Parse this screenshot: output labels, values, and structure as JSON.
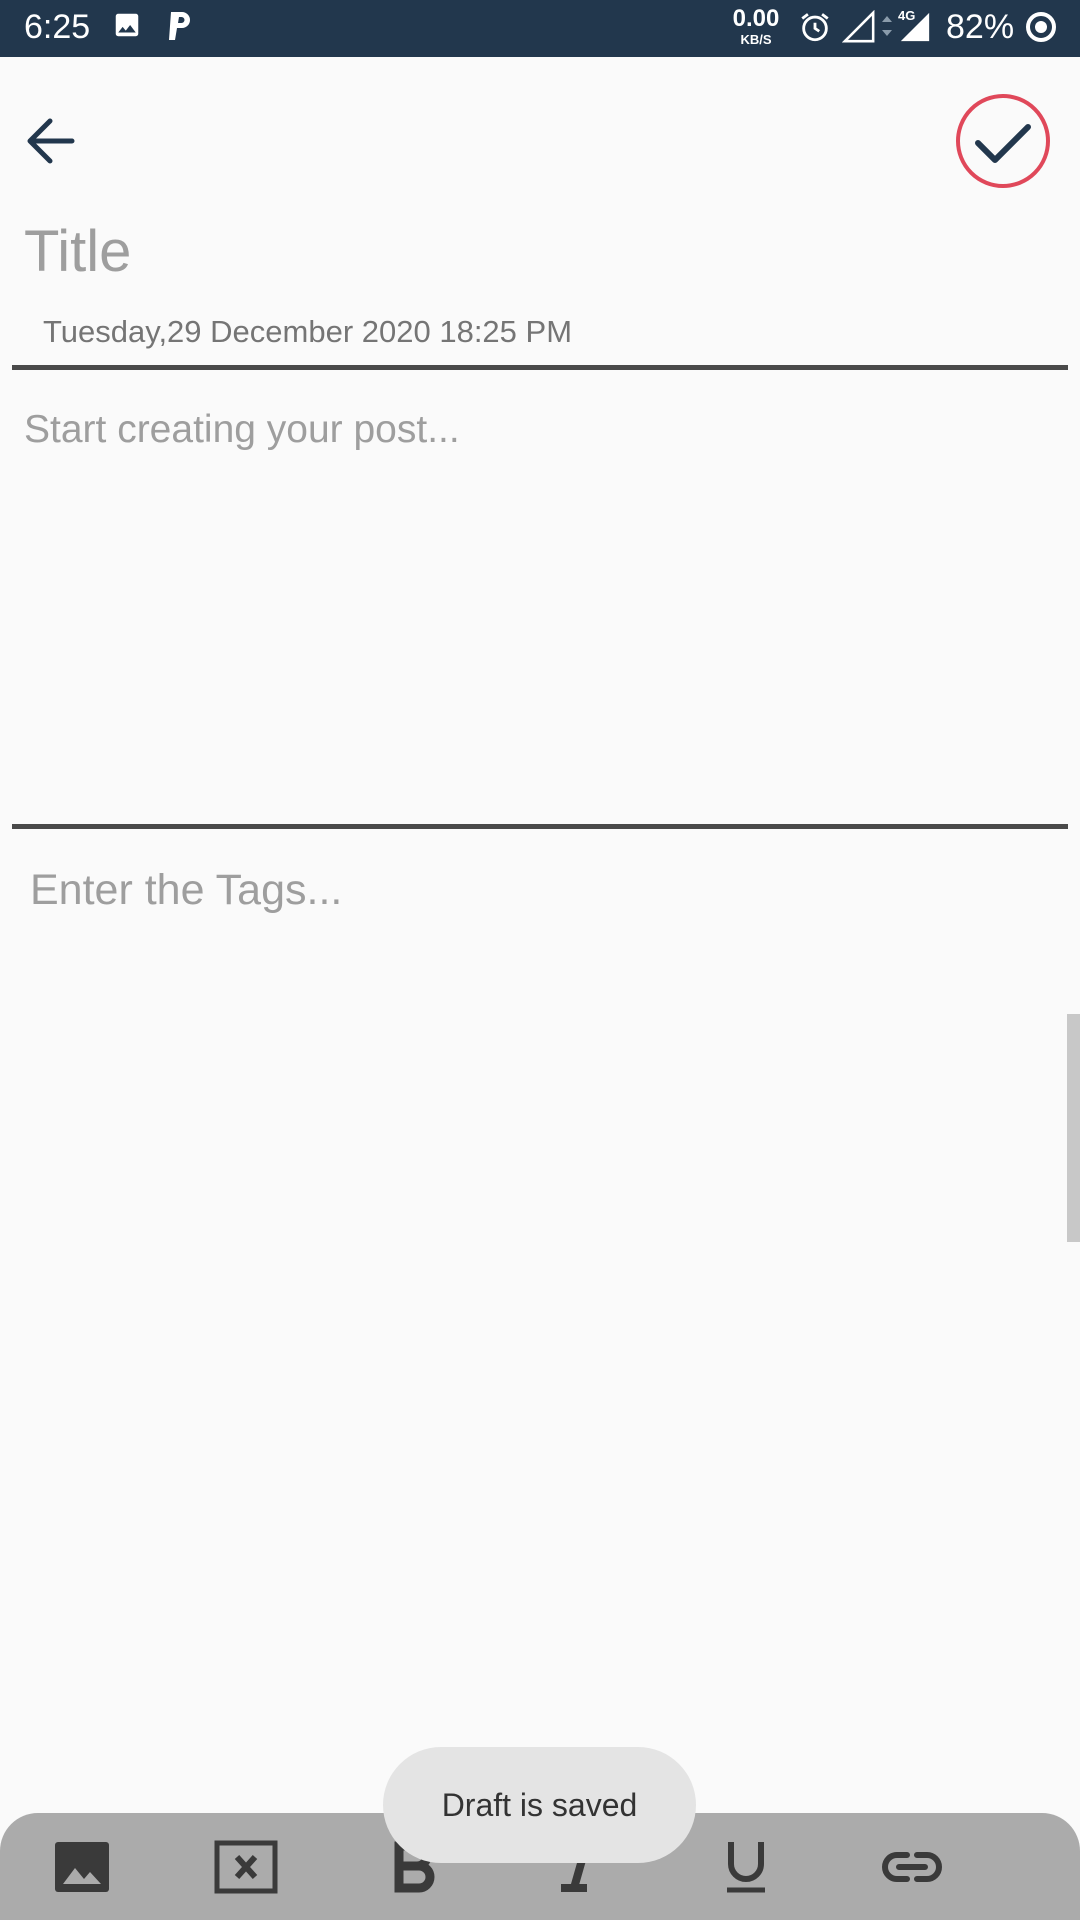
{
  "status_bar": {
    "time": "6:25",
    "network_speed_value": "0.00",
    "network_speed_unit": "KB/S",
    "network_type": "4G",
    "battery": "82%",
    "icons": [
      "image-icon",
      "p-app-icon",
      "alarm-icon",
      "signal-empty-icon",
      "signal-full-icon",
      "battery-ring-icon"
    ]
  },
  "header": {
    "back_icon": "arrow-left-icon",
    "save_icon": "check-circle-icon",
    "save_ring_color": "#e0485a"
  },
  "editor": {
    "title_placeholder": "Title",
    "date": "Tuesday,29 December 2020 18:25 PM",
    "body_placeholder": "Start creating your post...",
    "tags_placeholder": "Enter the Tags..."
  },
  "toast": {
    "message": "Draft is saved"
  },
  "toolbar": {
    "items": [
      "image-icon",
      "delete-box-icon",
      "bold-icon",
      "italic-icon",
      "underline-icon",
      "link-icon"
    ]
  },
  "colors": {
    "status_bar_bg": "#22374d",
    "toolbar_bg": "#ababab",
    "toolbar_icon": "#3a3a3a",
    "divider": "#4a4a4a"
  }
}
